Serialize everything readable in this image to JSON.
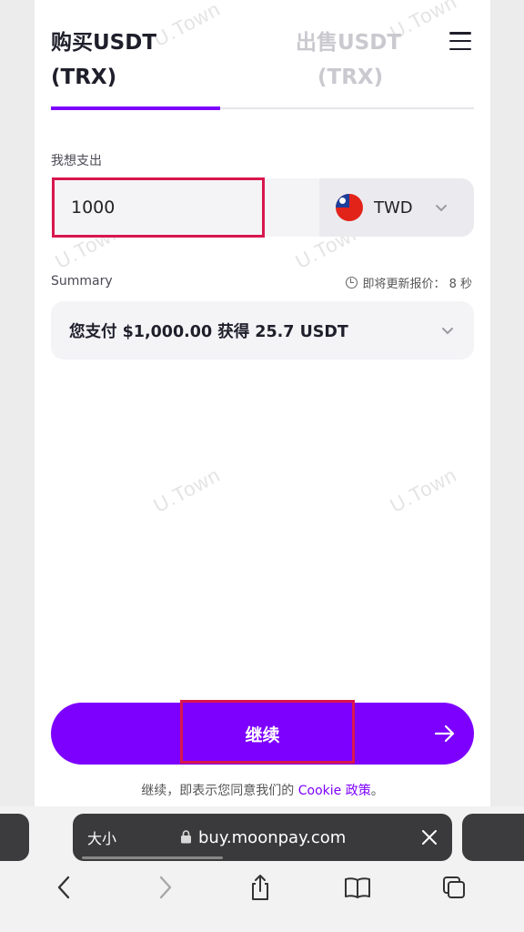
{
  "tabs": {
    "buy_line1": "购买USDT",
    "buy_line2": "(TRX)",
    "sell_line1": "出售USDT",
    "sell_line2": "(TRX)"
  },
  "form": {
    "spend_label": "我想支出",
    "amount_value": "1000",
    "currency_code": "TWD"
  },
  "summary": {
    "label": "Summary",
    "refresh_text": "即将更新报价： 8 秒",
    "text": "您支付 $1,000.00 获得 25.7 USDT"
  },
  "actions": {
    "continue_label": "继续",
    "policy_prefix": "继续，即表示您同意我们的 ",
    "policy_link": "Cookie 政策",
    "policy_suffix": "。"
  },
  "browser": {
    "text_size_label": "大小",
    "url": "buy.moonpay.com"
  },
  "watermark": "U.Town",
  "colors": {
    "accent": "#7d00ff",
    "highlight_box": "#d8164e"
  }
}
